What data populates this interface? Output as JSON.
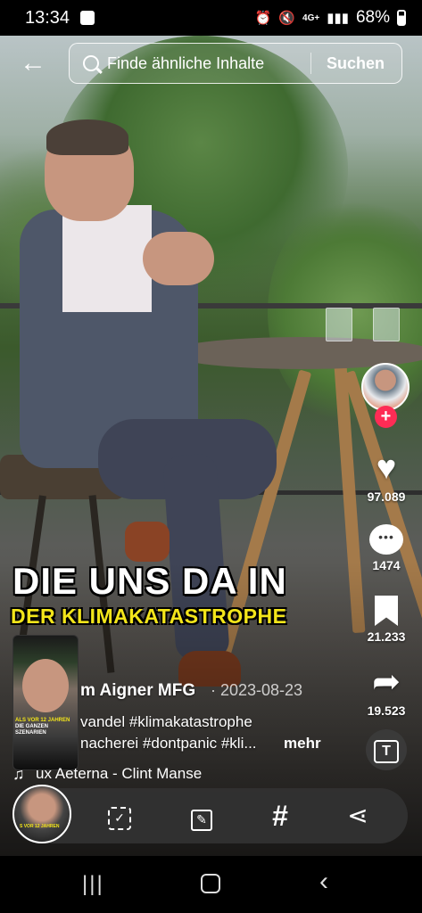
{
  "status_bar": {
    "time": "13:34",
    "network": "4G+",
    "battery": "68%"
  },
  "search": {
    "placeholder": "Finde ähnliche Inhalte",
    "button_label": "Suchen"
  },
  "video": {
    "caption_line1": "DIE UNS DA IN",
    "caption_line2": "DER KLIMAKATASTROPHE"
  },
  "actions": {
    "follow_label": "+",
    "likes": "97.089",
    "comments": "1474",
    "saves": "21.233",
    "shares": "19.523"
  },
  "info": {
    "author": "m Aigner MFG",
    "date": "· 2023-08-23",
    "description_line1": "vandel #klimakatastrophe",
    "description_line2": "nacherei #dontpanic #kli...",
    "more_label": "mehr",
    "music": "ux Aeterna - Clint Manse",
    "thumbnail_caption_a": "ALS VOR 12 JAHREN",
    "thumbnail_caption_b": "DIE GANZEN SZENARIEN"
  },
  "bottom_bar": {
    "thumb_caption": "S VOR 12 JAHREN"
  },
  "colors": {
    "accent_red": "#fe2c55",
    "caption_yellow": "#f3e51a"
  }
}
